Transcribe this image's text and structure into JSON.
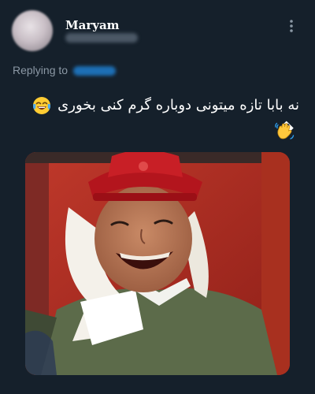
{
  "author": {
    "display_name": "Maryam"
  },
  "reply": {
    "label": "Replying to"
  },
  "tweet": {
    "line1": "نه بابا تازه میتونی دوباره گرم کنی بخوری",
    "line2": "�"
  },
  "icons": {
    "more": "more-vertical-icon",
    "emoji_1": "face-with-tears-of-joy-emoji",
    "emoji_2": "waving-hand-emoji"
  },
  "colors": {
    "background": "#15202b",
    "text_primary": "#ffffff",
    "text_secondary": "#8b98a5",
    "link": "#1d9bf0"
  }
}
